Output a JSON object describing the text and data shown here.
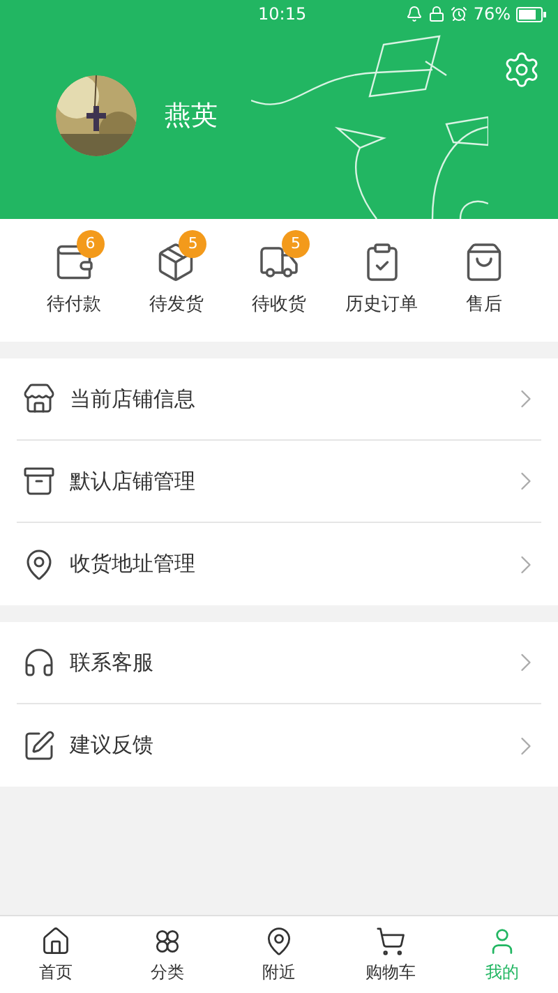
{
  "status_bar": {
    "time": "10:15",
    "battery": "76%"
  },
  "profile": {
    "name": "燕英"
  },
  "orders": [
    {
      "kind": "wallet",
      "label": "待付款",
      "badge": "6"
    },
    {
      "kind": "package",
      "label": "待发货",
      "badge": "5"
    },
    {
      "kind": "truck",
      "label": "待收货",
      "badge": "5"
    },
    {
      "kind": "history",
      "label": "历史订单"
    },
    {
      "kind": "bag",
      "label": "售后"
    }
  ],
  "menu_groups": [
    [
      {
        "kind": "store",
        "label": "当前店铺信息"
      },
      {
        "kind": "shop",
        "label": "默认店铺管理"
      },
      {
        "kind": "pin",
        "label": "收货地址管理"
      }
    ],
    [
      {
        "kind": "headset",
        "label": "联系客服"
      },
      {
        "kind": "edit",
        "label": "建议反馈"
      }
    ]
  ],
  "tab_bar": [
    {
      "kind": "home",
      "label": "首页",
      "selected": false
    },
    {
      "kind": "category",
      "label": "分类",
      "selected": false
    },
    {
      "kind": "nearby",
      "label": "附近",
      "selected": false
    },
    {
      "kind": "cart",
      "label": "购物车",
      "selected": false
    },
    {
      "kind": "me",
      "label": "我的",
      "selected": true
    }
  ]
}
